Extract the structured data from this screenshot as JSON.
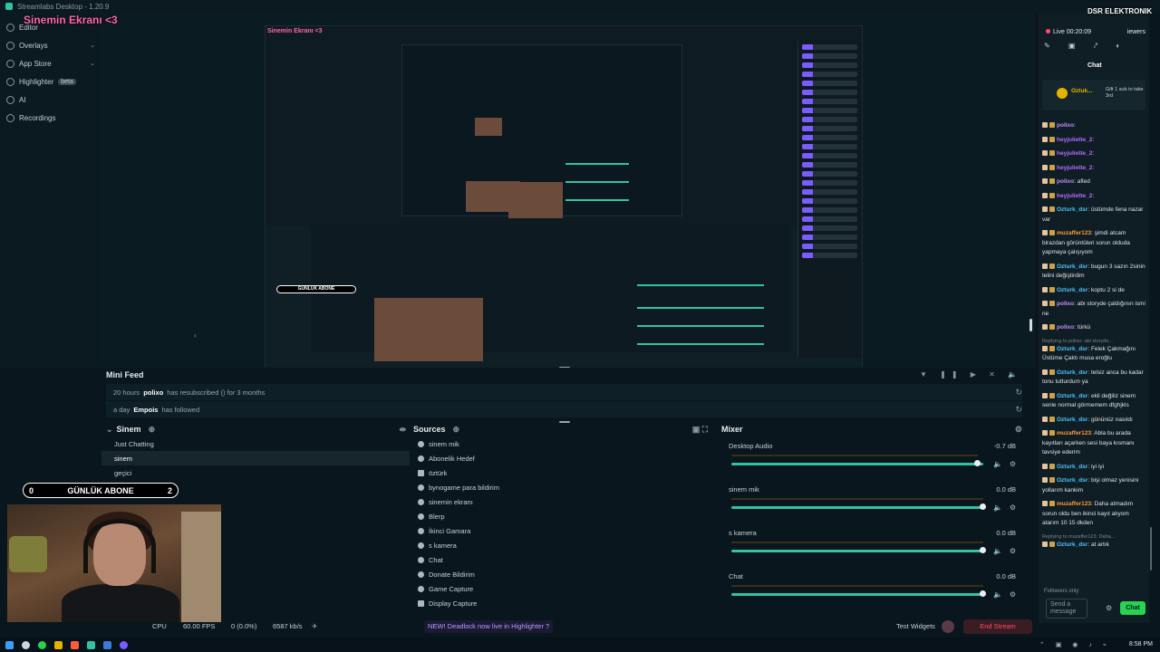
{
  "window": {
    "title": "Streamlabs Desktop - 1.20.9"
  },
  "overlay": {
    "title": "Sinemin Ekranı <3",
    "brand": "DSR ELEKTRONIK"
  },
  "sidebar": {
    "items": [
      {
        "label": "Editor",
        "chevron": ""
      },
      {
        "label": "Overlays",
        "chevron": "⌄"
      },
      {
        "label": "App Store",
        "chevron": "⌄"
      },
      {
        "label": "Highlighter",
        "badge": "beta"
      },
      {
        "label": "AI"
      },
      {
        "label": "Recordings"
      }
    ]
  },
  "minifeed": {
    "title": "Mini Feed",
    "events": [
      {
        "time": "20 hours",
        "user": "polixo",
        "text": "has resubscribed () for 3 months"
      },
      {
        "time": "a day",
        "user": "Empois",
        "text": "has followed"
      }
    ]
  },
  "scenes": {
    "title": "Sinem",
    "items": [
      "Just Chatting",
      "sinem",
      "geçici"
    ],
    "active_index": 1
  },
  "sources": {
    "title": "Sources",
    "items": [
      "sinem mik",
      "Abonelik Hedef",
      "öztürk",
      "bynogame para bildirim",
      "sinemin ekranı",
      "Blerp",
      "İkinci Gamara",
      "s kamera",
      "Chat",
      "Donate Bildirim",
      "Game Capture",
      "Display Capture"
    ]
  },
  "mixer": {
    "title": "Mixer",
    "channels": [
      {
        "name": "Desktop Audio",
        "db": "-0.7 dB",
        "level": 0.98
      },
      {
        "name": "sinem mik",
        "db": "0.0 dB",
        "level": 1.0
      },
      {
        "name": "s kamera",
        "db": "0.0 dB",
        "level": 1.0
      },
      {
        "name": "Chat",
        "db": "0.0 dB",
        "level": 1.0
      }
    ]
  },
  "abone": {
    "left": "0",
    "label": "GÜNLÜK ABONE",
    "right": "2"
  },
  "status": {
    "cpu": "CPU",
    "fps": "60.00 FPS",
    "dropped": "0 (0.0%)",
    "bitrate": "6587 kb/s",
    "highlight": "NEW! Deadlock now live in Highlighter ?",
    "test_widgets": "Test Widgets",
    "end_stream": "End Stream"
  },
  "chat": {
    "live": "Live 00:20:09",
    "viewers": "iewers",
    "tab": "Chat",
    "pinned": {
      "name": "Oztuk...",
      "text": "Gift 1 sub to take 3rd"
    },
    "messages": [
      {
        "user": "polixo",
        "text": "",
        "color": "#c48cff"
      },
      {
        "user": "heyjuliette_2",
        "text": "",
        "color": "#b86bff"
      },
      {
        "user": "heyjuliette_2",
        "text": "",
        "color": "#b86bff"
      },
      {
        "user": "heyjuliette_2",
        "text": "",
        "color": "#b86bff"
      },
      {
        "user": "polixo",
        "text": "afled",
        "color": "#c48cff"
      },
      {
        "user": "heyjuliette_2",
        "text": "",
        "color": "#b86bff"
      },
      {
        "user": "Ozturk_dsr",
        "text": "üstümde fena nazar var",
        "color": "#4fc3ff"
      },
      {
        "user": "muzaffer123",
        "text": "şimdi atcam birazdan görüntüleri sorun olduda yapmaya çalışıyom",
        "color": "#ff9a3c"
      },
      {
        "user": "Ozturk_dsr",
        "text": "bugun 3 sazın 2sinin telini değiştirdim",
        "color": "#4fc3ff"
      },
      {
        "user": "Ozturk_dsr",
        "text": "koptu 2 si de",
        "color": "#4fc3ff"
      },
      {
        "user": "polixo",
        "text": "abi storyde çaldığının ismi ne",
        "color": "#c48cff"
      },
      {
        "user": "polixo",
        "text": "türkü",
        "color": "#c48cff"
      },
      {
        "user": "Ozturk_dsr",
        "text": "Felek Çakmağını Üstüme Çaktı musa eroğlu",
        "color": "#4fc3ff",
        "reply": "Replying to polixo: abi storyde..."
      },
      {
        "user": "Ozturk_dsr",
        "text": "telsiz anca bu kadar tonu tutturdum ya",
        "color": "#4fc3ff"
      },
      {
        "user": "Ozturk_dsr",
        "text": "ekli değiliz sinem senle normal görmemem dfghjkls",
        "color": "#4fc3ff"
      },
      {
        "user": "Ozturk_dsr",
        "text": "gününüz nasıldı",
        "color": "#4fc3ff"
      },
      {
        "user": "muzaffer123",
        "text": "Abla bu arada kayıtları açarken sesi baya kısmanı tavsiye ederim",
        "color": "#ff9a3c"
      },
      {
        "user": "Ozturk_dsr",
        "text": "iyi iyi",
        "color": "#4fc3ff"
      },
      {
        "user": "Ozturk_dsr",
        "text": "bişi olmaz yenisini yollarım kankim",
        "color": "#4fc3ff"
      },
      {
        "user": "muzaffer123",
        "text": "Daha atmadım sorun oldu ben ikinci kayıt alıyom atarım 10 15 dkden",
        "color": "#ff9a3c"
      },
      {
        "user": "Ozturk_dsr",
        "text": "at artık",
        "color": "#4fc3ff",
        "reply": "Replying to muzaffer123: Daha..."
      }
    ],
    "followers_only": "Followers only",
    "input_placeholder": "Send a message",
    "send": "Chat"
  },
  "taskbar": {
    "time": "8:58 PM"
  }
}
